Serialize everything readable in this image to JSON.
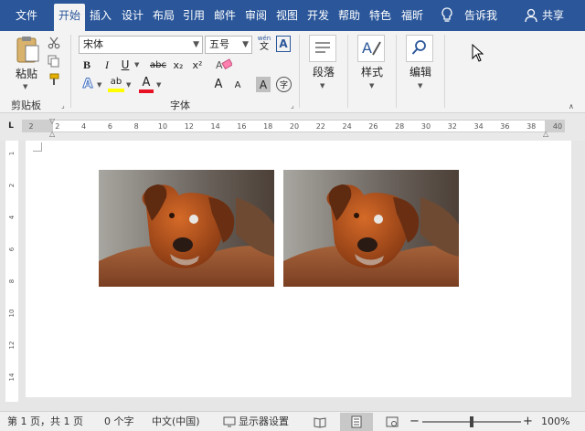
{
  "tabs": {
    "file": "文件",
    "home": "开始",
    "insert": "插入",
    "design": "设计",
    "layout": "布局",
    "references": "引用",
    "mailings": "邮件",
    "review": "审阅",
    "view": "视图",
    "developer": "开发",
    "help": "帮助",
    "special": "特色",
    "foxit": "福昕",
    "tell_me": "告诉我",
    "share": "共享"
  },
  "ribbon": {
    "clipboard": {
      "paste_label": "粘贴",
      "group_label": "剪贴板"
    },
    "font": {
      "font_name": "宋体",
      "font_size": "五号",
      "group_label": "字体",
      "bold": "B",
      "italic": "I",
      "underline": "U",
      "strikethrough": "abc",
      "subscript": "x₂",
      "superscript": "x²",
      "grow_font": "A",
      "shrink_font": "A",
      "char_shading": "A",
      "enclose": "字",
      "phonetic": "wén",
      "phonetic_char": "文",
      "char_border": "A",
      "text_effect": "A",
      "highlight": "ab",
      "font_color": "A"
    },
    "paragraph": {
      "label": "段落"
    },
    "styles": {
      "label": "样式"
    },
    "editing": {
      "label": "编辑"
    }
  },
  "ruler": {
    "corner": "L",
    "ticks": [
      "2",
      "2",
      "4",
      "6",
      "8",
      "10",
      "12",
      "14",
      "16",
      "18",
      "20",
      "22",
      "24",
      "26",
      "28",
      "30",
      "32",
      "34",
      "36",
      "38",
      "40"
    ],
    "vticks": [
      "1",
      "2",
      "4",
      "6",
      "8",
      "10",
      "12",
      "14"
    ]
  },
  "status": {
    "page": "第 1 页，共 1 页",
    "words": "0 个字",
    "language": "中文(中国)",
    "display_settings": "显示器设置",
    "zoom": "100%",
    "zoom_minus": "−",
    "zoom_plus": "+"
  },
  "colors": {
    "accent": "#2b579a",
    "highlight_yellow": "#ffff00",
    "font_color_red": "#e81123"
  },
  "icons": {
    "paste": "clipboard-icon",
    "cut": "scissors-icon",
    "copy": "copy-icon",
    "format_painter": "paintbrush-icon",
    "clear_format": "eraser-icon",
    "paragraph": "paragraph-lines-icon",
    "styles": "styles-icon",
    "editing": "magnifier-icon",
    "tell_me": "lightbulb-icon",
    "share": "person-icon"
  }
}
